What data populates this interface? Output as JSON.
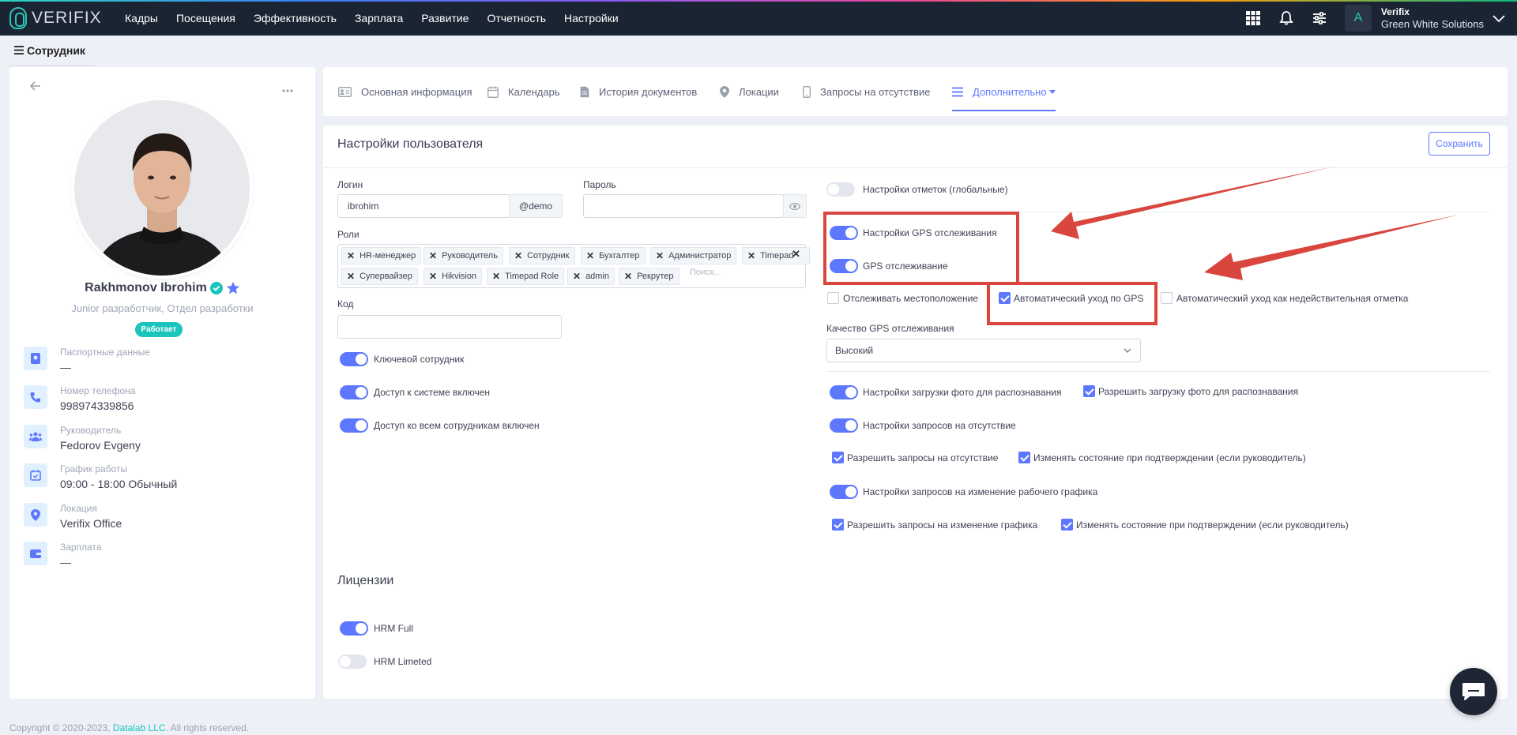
{
  "app": {
    "logo_text": "VERIFIX",
    "nav": [
      "Кадры",
      "Посещения",
      "Эффективность",
      "Зарплата",
      "Развитие",
      "Отчетность",
      "Настройки"
    ],
    "account": {
      "avatar_letter": "A",
      "name": "Verifix",
      "company": "Green White Solutions"
    }
  },
  "page": {
    "title": "Сотрудник"
  },
  "employee": {
    "name": "Rakhmonov Ibrohim",
    "role": "Junior разработчик, Отдел разработки",
    "status": "Работает",
    "info": [
      {
        "label": "Паспортные данные",
        "value": "—",
        "icon": "passport-icon"
      },
      {
        "label": "Номер телефона",
        "value": "998974339856",
        "icon": "phone-icon"
      },
      {
        "label": "Руководитель",
        "value": "Fedorov Evgeny",
        "icon": "users-icon"
      },
      {
        "label": "График работы",
        "value": "09:00 - 18:00 Обычный",
        "icon": "calendar-check-icon"
      },
      {
        "label": "Локация",
        "value": "Verifix Office",
        "icon": "location-icon"
      },
      {
        "label": "Зарплата",
        "value": "—",
        "icon": "wallet-icon"
      }
    ]
  },
  "tabs": [
    {
      "label": "Основная информация",
      "icon": "id-card-icon"
    },
    {
      "label": "Календарь",
      "icon": "calendar-icon"
    },
    {
      "label": "История документов",
      "icon": "document-icon"
    },
    {
      "label": "Локации",
      "icon": "map-pin-icon"
    },
    {
      "label": "Запросы на отсутствие",
      "icon": "mobile-icon"
    },
    {
      "label": "Дополнительно",
      "icon": "list-icon",
      "active": true
    }
  ],
  "settings": {
    "title": "Настройки пользователя",
    "save_label": "Сохранить",
    "login": {
      "label": "Логин",
      "value": "ibrohim",
      "suffix": "@demo"
    },
    "password": {
      "label": "Пароль",
      "value": ""
    },
    "roles": {
      "label": "Роли",
      "items": [
        "HR-менеджер",
        "Руководитель",
        "Сотрудник",
        "Бухгалтер",
        "Администратор",
        "Timepad",
        "Супервайзер",
        "Hikvision",
        "Timepad Role",
        "admin",
        "Рекрутер"
      ],
      "search_placeholder": "Поиск..."
    },
    "code": {
      "label": "Код",
      "value": ""
    },
    "left_toggles": [
      {
        "label": "Ключевой сотрудник",
        "on": true
      },
      {
        "label": "Доступ к системе включен",
        "on": true
      },
      {
        "label": "Доступ ко всем сотрудникам включен",
        "on": true
      }
    ],
    "marks_global": {
      "label": "Настройки отметок (глобальные)",
      "on": false
    },
    "gps_settings": {
      "label": "Настройки GPS отслеживания",
      "on": true
    },
    "gps_tracking": {
      "label": "GPS отслеживание",
      "on": true
    },
    "track_location": {
      "label": "Отслеживать местоположение",
      "checked": false
    },
    "auto_leave_gps": {
      "label": "Автоматический уход по GPS",
      "checked": true
    },
    "auto_leave_invalid": {
      "label": "Автоматический уход как недействительная отметка",
      "checked": false
    },
    "gps_quality": {
      "label": "Качество GPS отслеживания",
      "value": "Высокий"
    },
    "photo_upload": {
      "label": "Настройки загрузки фото для распознавания",
      "on": true
    },
    "allow_photo": {
      "label": "Разрешить загрузку фото для распознавания",
      "checked": true
    },
    "absence_requests": {
      "label": "Настройки запросов на отсутствие",
      "on": true
    },
    "allow_absence": {
      "label": "Разрешить запросы на отсутствие",
      "checked": true
    },
    "absence_change_state": {
      "label": "Изменять состояние при подтверждении (если руководитель)",
      "checked": true
    },
    "schedule_requests": {
      "label": "Настройки запросов на изменение рабочего графика",
      "on": true
    },
    "allow_schedule": {
      "label": "Разрешить запросы на изменение графика",
      "checked": true
    },
    "schedule_change_state": {
      "label": "Изменять состояние при подтверждении (если руководитель)",
      "checked": true
    }
  },
  "licenses": {
    "title": "Лицензии",
    "items": [
      {
        "label": "HRM Full",
        "on": true
      },
      {
        "label": "HRM Limeted",
        "on": false
      }
    ]
  },
  "footer": {
    "text": "Copyright © 2020-2023, ",
    "link": "Datalab LLC",
    "suffix": ". All rights reserved."
  },
  "colors": {
    "accent": "#5d78ff",
    "success": "#1bc5bd",
    "topbar": "#1b2433",
    "annotation": "#d9463e"
  }
}
